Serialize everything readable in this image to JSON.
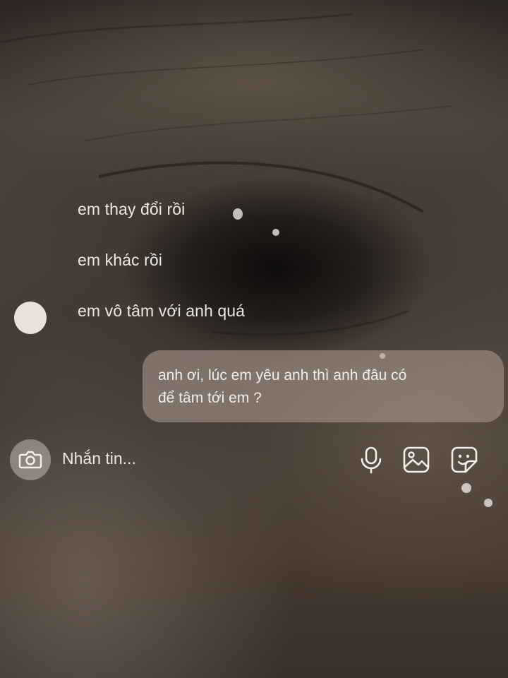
{
  "messages_received": [
    {
      "text": "em thay đổi rồi"
    },
    {
      "text": "em khác rồi"
    },
    {
      "text": "em vô tâm với anh quá"
    }
  ],
  "message_sent": {
    "line1": "anh ơi, lúc em yêu anh thì anh đâu có",
    "line2": "để tâm tới em ?"
  },
  "composer": {
    "placeholder": "Nhắn tin...",
    "icons": [
      "camera-icon",
      "microphone-icon",
      "image-icon",
      "sticker-icon"
    ]
  },
  "colors": {
    "text": "#ece7e2",
    "bubble": "#afa096",
    "avatar": "#e9e1dc"
  }
}
